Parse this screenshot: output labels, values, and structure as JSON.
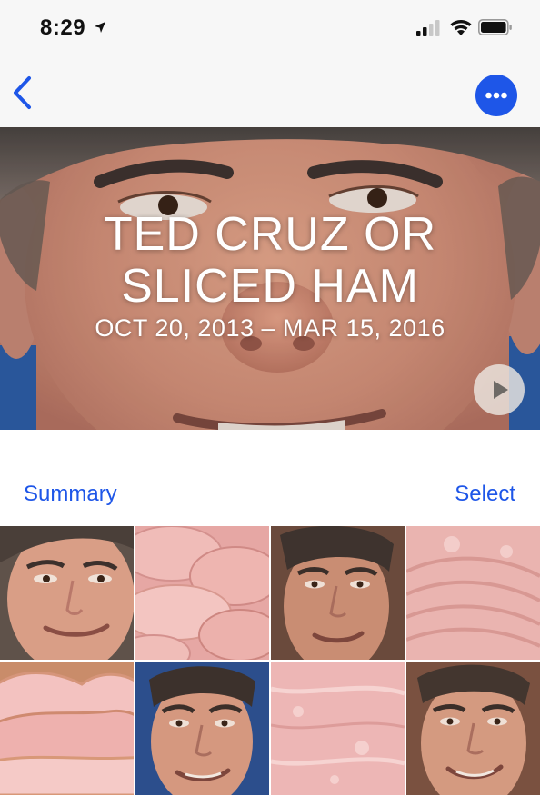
{
  "status_bar": {
    "time": "8:29"
  },
  "nav": {
    "back_icon": "chevron-left-icon",
    "more_icon": "ellipsis-icon",
    "accent_color": "#1e56e8"
  },
  "memory": {
    "title_line_1": "TED CRUZ OR",
    "title_line_2": "SLICED HAM",
    "date_range": "OCT 20, 2013 – MAR 15, 2016",
    "play_icon": "play-icon"
  },
  "section": {
    "summary_label": "Summary",
    "select_label": "Select"
  },
  "photos": [
    {
      "kind": "face"
    },
    {
      "kind": "ham"
    },
    {
      "kind": "face"
    },
    {
      "kind": "ham"
    },
    {
      "kind": "ham"
    },
    {
      "kind": "face"
    },
    {
      "kind": "ham"
    },
    {
      "kind": "face"
    }
  ]
}
